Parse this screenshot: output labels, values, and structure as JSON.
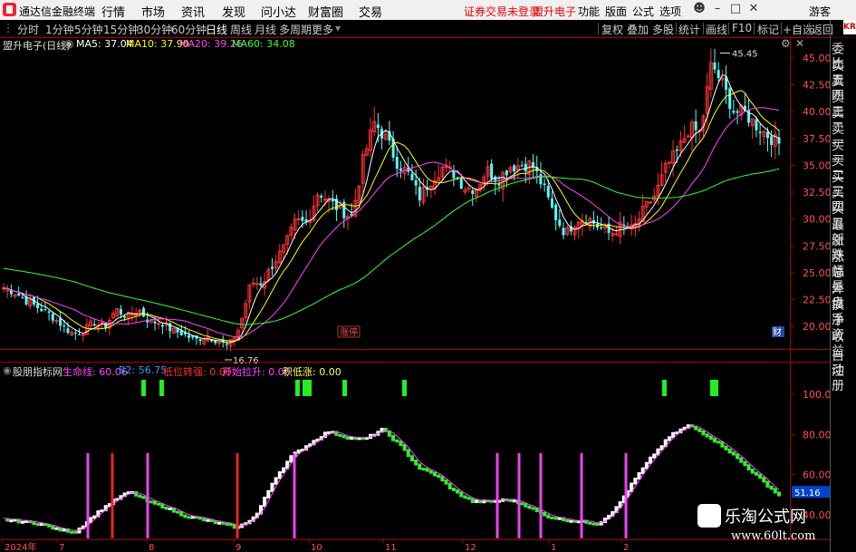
{
  "app": {
    "title": "通达信金融终端",
    "login_notice": "证券交易未登录",
    "stock_title_top": "盟升电子"
  },
  "menu": [
    "行情",
    "市场",
    "资讯",
    "发现",
    "问小达",
    "财富圈",
    "交易"
  ],
  "right_menu": [
    "功能",
    "版面",
    "公式",
    "选项"
  ],
  "guest": "游客",
  "periods": [
    "分时",
    "1分钟",
    "5分钟",
    "15分钟",
    "30分钟",
    "60分钟",
    "日线",
    "周线",
    "月线",
    "多周期",
    "更多"
  ],
  "active_period": "日线",
  "toolbar_right": [
    "复权",
    "叠加",
    "多股",
    "统计",
    "画线",
    "F10",
    "标记",
    "+自选",
    "返回"
  ],
  "kr_badge": "KR",
  "main_info": {
    "stock": "盟升电子(日线)",
    "ma": [
      {
        "label": "MA5: 37.04",
        "color": "#ffffff"
      },
      {
        "label": "MA10: 37.90",
        "color": "#ffff00"
      },
      {
        "label": "MA20: 39.26",
        "color": "#ff44ff"
      },
      {
        "label": "MA60: 34.08",
        "color": "#33ff33"
      }
    ]
  },
  "sub_info": {
    "name": "股朋指标网",
    "items": [
      {
        "label": "生命线: 60.06",
        "color": "#ff44ff"
      },
      {
        "label": "B2: 56.75",
        "color": "#3399ff"
      },
      {
        "label": "低位转强: 0.00",
        "color": "#ff3333"
      },
      {
        "label": "开始拉升: 0.00",
        "color": "#ff44ff"
      },
      {
        "label": "积低涨: 0.00",
        "color": "#ffff66"
      }
    ]
  },
  "price_axis": [
    "45.00",
    "42.50",
    "40.00",
    "37.50",
    "35.00",
    "32.50",
    "30.00",
    "27.50",
    "25.00",
    "22.50",
    "20.00"
  ],
  "ind_axis": [
    "100.0",
    "80.00",
    "60.00",
    "40.00"
  ],
  "ind_current": "51.16",
  "annotations": {
    "high": "45.45",
    "low": "16.76",
    "zt_tag": "涨停",
    "cai_tag": "财"
  },
  "date_axis": [
    "2024年",
    "7",
    "8",
    "9",
    "10",
    "11",
    "12",
    "1",
    "2"
  ],
  "side_labels": [
    "委比",
    "卖五",
    "卖四",
    "卖三",
    "卖二",
    "卖一",
    "买一",
    "买二",
    "买三",
    "买四",
    "买五",
    "最新",
    "涨跌",
    "涨幅",
    "总量",
    "外盘",
    "换手",
    "净资",
    "收益"
  ],
  "side_labels2": [
    "自动",
    "注册"
  ],
  "watermark": {
    "cn": "乐淘公式网",
    "url": "www.60lt.com"
  },
  "colors": {
    "up": "#ff3232",
    "down": "#54ffff",
    "ma5": "#ffffff",
    "ma10": "#ffff00",
    "ma20": "#ff44ff",
    "ma60": "#33ff33",
    "axis": "#aa0000"
  },
  "chart_data": {
    "type": "candlestick",
    "symbol": "盟升电子",
    "period": "daily",
    "y_range": [
      18.5,
      46.0
    ],
    "indicator_range": [
      30,
      110
    ],
    "price_anchors_close": [
      23.6,
      23.2,
      22.4,
      21.8,
      21.2,
      20.3,
      19.4,
      19.5,
      20.4,
      19.9,
      21.6,
      20.9,
      21.6,
      20.4,
      20.4,
      19.6,
      19.3,
      18.7,
      19.1,
      18.7,
      18.1,
      19.9,
      24.1,
      24.0,
      25.9,
      27.4,
      29.8,
      29.6,
      32.6,
      31.6,
      30.8,
      30.2,
      35.5,
      39.0,
      37.5,
      35.3,
      34.2,
      32.0,
      33.6,
      34.8,
      34.3,
      33.0,
      32.8,
      34.6,
      33.6,
      34.9,
      35.0,
      35.1,
      33.0,
      30.4,
      28.6,
      30.0,
      30.1,
      29.2,
      28.6,
      29.4,
      29.0,
      30.9,
      32.3,
      34.9,
      36.3,
      38.5,
      38.0,
      44.5,
      42.4,
      40.0,
      39.8,
      38.7,
      37.8,
      37.0
    ],
    "indicator_anchors": [
      38,
      37,
      36,
      33,
      32,
      40,
      47,
      52,
      47,
      44,
      40,
      38,
      36,
      34,
      40,
      58,
      70,
      76,
      82,
      79,
      78,
      83,
      75,
      64,
      60,
      52,
      47,
      47,
      48,
      45,
      40,
      38,
      37,
      36,
      44,
      58,
      70,
      80,
      85,
      80,
      74,
      66,
      58,
      50
    ],
    "signal_columns_green": 11,
    "pink_bars": 9,
    "red_bars": 2
  }
}
